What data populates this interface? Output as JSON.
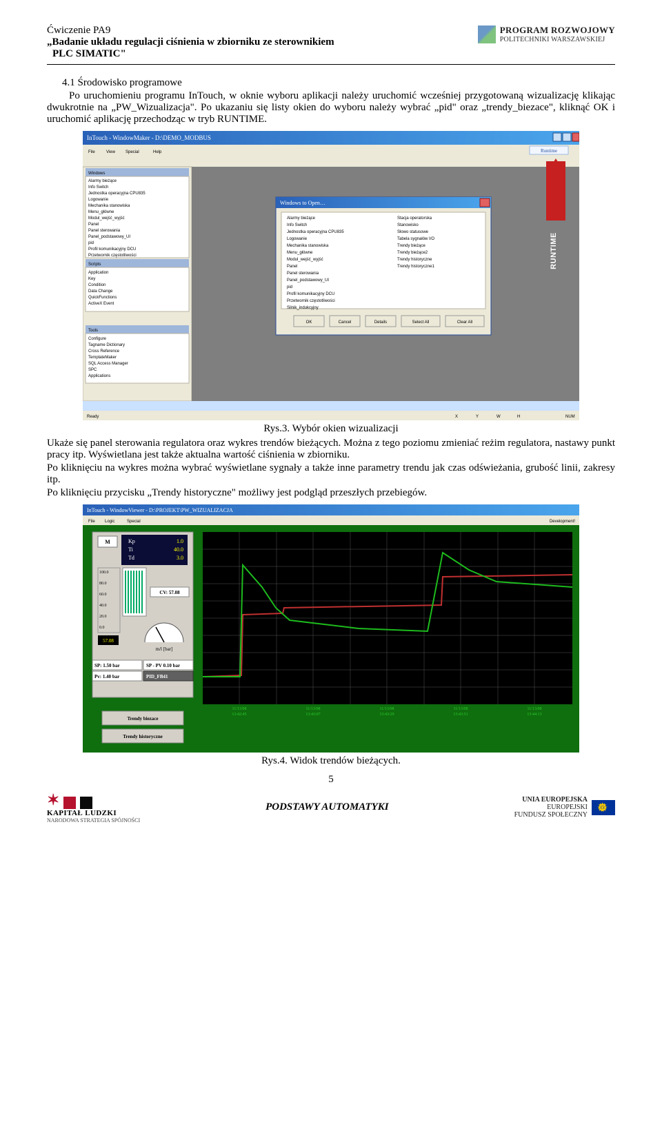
{
  "header": {
    "line1": "Ćwiczenie PA9",
    "line2": "„Badanie układu regulacji ciśnienia w zbiorniku ze sterownikiem",
    "line3": "PLC SIMATIC\"",
    "logo_line1": "PROGRAM ROZWOJOWY",
    "logo_line2": "POLITECHNIKI WARSZAWSKIEJ"
  },
  "content": {
    "section_title": "4.1 Środowisko programowe",
    "para1": "Po uruchomieniu programu InTouch, w oknie wyboru aplikacji należy uruchomić wcześniej przygotowaną wizualizację klikając dwukrotnie na „PW_Wizualizacja\". Po ukazaniu się listy okien do wyboru należy wybrać „pid\" oraz „trendy_biezace\", kliknąć OK i uruchomić aplikację przechodząc w tryb RUNTIME.",
    "fig1_caption": "Rys.3. Wybór okien wizualizacji",
    "para2": "Ukaże się panel sterowania regulatora oraz wykres trendów bieżących. Można z tego poziomu zmieniać reżim regulatora, nastawy punkt pracy itp. Wyświetlana jest także aktualna wartość ciśnienia w zbiorniku.",
    "para3": "Po kliknięciu na wykres można wybrać wyświetlane sygnały a także inne parametry trendu jak czas odświeżania, grubość linii, zakresy itp.",
    "para4": "Po kliknięciu przycisku „Trendy historyczne\" możliwy jest podgląd przeszłych przebiegów.",
    "fig2_caption": "Rys.4. Widok trendów bieżących.",
    "page_num": "5"
  },
  "fig1": {
    "app_title": "InTouch - WindowMaker - D:\\DEMO_MODBUS",
    "menu": [
      "File",
      "View",
      "Special",
      "Help"
    ],
    "runtime_btn_label": "Runtime",
    "panel_title_windows": "Windows",
    "left_windows": [
      "Alarmy bieżące",
      "Info Switch",
      "Jednostka operacyjna CPU835",
      "Logowanie",
      "Mechanika stanowiska",
      "Menu_główne",
      "Modul_wejść_wyjść",
      "Panel",
      "Panel sterowania",
      "Panel_podstawowy_UI",
      "pid",
      "Profil komunikacyjny DCU",
      "Przetwornik częstotliwości"
    ],
    "panel_title_scripts": "Scripts",
    "scripts": [
      "Application",
      "Key",
      "Condition",
      "Data Change",
      "QuickFunctions",
      "ActiveX Event"
    ],
    "panel_title_tools": "Tools",
    "tools": [
      "Configure",
      "Tagname Dictionary",
      "Cross Reference",
      "TemplateMaker",
      "SQL Access Manager",
      "SPC",
      "Applications"
    ],
    "dialog_title": "Windows to Open…",
    "dialog_list_left": [
      "Alarmy bieżące",
      "Info Switch",
      "Jednostka operacyjna CPU835",
      "Logowanie",
      "Mechanika stanowiska",
      "Menu_główne",
      "Modul_wejść_wyjść",
      "Panel",
      "Panel sterowania",
      "Panel_podstawowy_UI",
      "pid",
      "Profil komunikacyjny DCU",
      "Przetwornik częstotliwości",
      "Silnik_indukcyjny"
    ],
    "dialog_list_right": [
      "Stacja operatorska",
      "Stanowisko",
      "Słowo statusowe",
      "Tabela sygnałów I/O",
      "Trendy bieżące",
      "Trendy bieżące2",
      "Trendy historyczne",
      "Trendy historyczne1"
    ],
    "dialog_buttons": [
      "OK",
      "Cancel",
      "Details",
      "Select All",
      "Clear All"
    ],
    "runtime_annot": "RUNTIME",
    "status_bar": [
      "Ready",
      "X",
      "Y",
      "W",
      "H",
      "NUM"
    ]
  },
  "fig2": {
    "app_title": "InTouch - WindowViewer - D:\\PROJEKT\\PW_WIZUALIZACJA",
    "menu": [
      "File",
      "Logic",
      "Special"
    ],
    "top_right": "Development!",
    "pid": {
      "Kp": "1.0",
      "Ti": "40.0",
      "Td": "3.0"
    },
    "cv_label": "CV: 57.08",
    "pv_label": "m/l [bar]",
    "scale": [
      "100.0",
      "80.0",
      "60.0",
      "40.0",
      "20.0",
      "0.0",
      "57.08"
    ],
    "sp": {
      "label": "SP:",
      "val": "1.50",
      "unit": "bar"
    },
    "pv": {
      "label": "Pv:",
      "val": "1.40",
      "unit": "bar"
    },
    "sp_pv": "SP - PV 0.10 bar",
    "pid_block": "PID_FB41",
    "btn_biezace": "Trendy biezace",
    "btn_historyczne": "Trendy historyczne",
    "time_labels": [
      {
        "d": "11/13/08",
        "t": "13:42:45"
      },
      {
        "d": "11/13/08",
        "t": "13:43:07"
      },
      {
        "d": "11/13/08",
        "t": "13:43:29"
      },
      {
        "d": "11/13/08",
        "t": "13:43:51"
      },
      {
        "d": "11/13/08",
        "t": "13:44:13"
      }
    ]
  },
  "footer": {
    "kl_line1": "KAPITAŁ LUDZKI",
    "kl_line2": "NARODOWA STRATEGIA SPÓJNOŚCI",
    "center": "PODSTAWY AUTOMATYKI",
    "eu_line1": "UNIA EUROPEJSKA",
    "eu_line2": "EUROPEJSKI",
    "eu_line3": "FUNDUSZ SPOŁECZNY"
  }
}
